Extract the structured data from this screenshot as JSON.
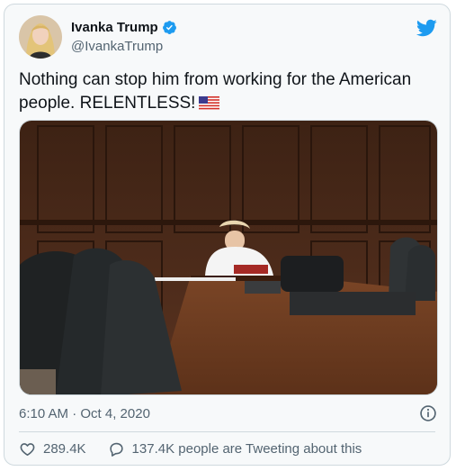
{
  "author": {
    "name": "Ivanka Trump",
    "handle": "@IvankaTrump",
    "verified": true
  },
  "tweet": {
    "text": "Nothing can stop him from working for the American people. RELENTLESS!",
    "emoji": "us-flag-emoji",
    "timestamp": "6:10 AM · Oct 4, 2020"
  },
  "media": {
    "description": "photo"
  },
  "actions": {
    "likes": "289.4K",
    "conversation": "137.4K people are Tweeting about this"
  },
  "colors": {
    "accent": "#1d9bf0",
    "secondary_text": "#536471",
    "border": "#cfd9de",
    "card_bg": "#f7f9fa"
  },
  "icons": [
    "verified-icon",
    "twitter-bird-icon",
    "info-icon",
    "heart-icon",
    "comment-icon",
    "us-flag-emoji"
  ]
}
